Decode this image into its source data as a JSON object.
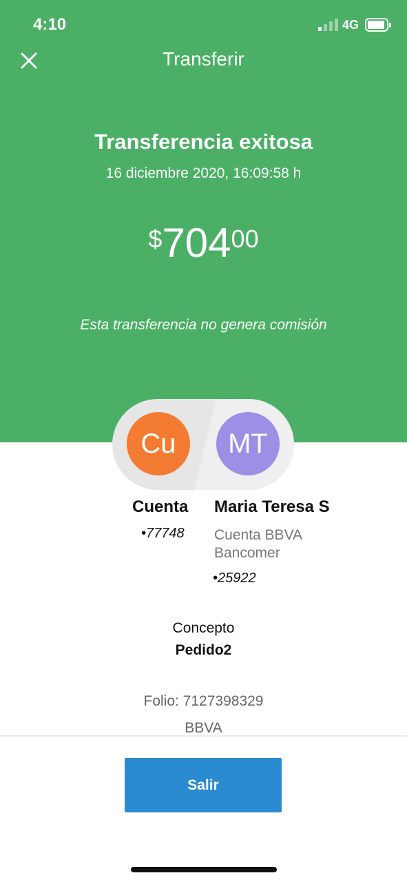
{
  "status_bar": {
    "time": "4:10",
    "network": "4G",
    "signal_bars_filled": 1,
    "signal_bars_total": 4,
    "battery_icon": "battery-full-icon"
  },
  "header": {
    "title": "Transferir",
    "close_icon": "close-icon"
  },
  "receipt": {
    "title": "Transferencia exitosa",
    "datetime": "16 diciembre 2020, 16:09:58 h",
    "amount": {
      "currency": "$",
      "integer": "704",
      "cents": "00"
    },
    "commission_note": "Esta transferencia no genera comisión"
  },
  "from": {
    "initials": "Cu",
    "name": "Cuenta",
    "account": "•77748",
    "avatar_color": "#f47b32"
  },
  "to": {
    "initials": "MT",
    "name": "Maria Teresa S",
    "bank_line1": "Cuenta BBVA",
    "bank_line2": "Bancomer",
    "account": "•25922",
    "avatar_color": "#9d8ee6"
  },
  "details": {
    "concept_label": "Concepto",
    "concept_value": "Pedido2",
    "folio": "Folio: 7127398329",
    "bank": "BBVA"
  },
  "actions": {
    "exit_label": "Salir"
  },
  "colors": {
    "header_green": "#4bb065",
    "button_blue": "#2b8bd1"
  }
}
